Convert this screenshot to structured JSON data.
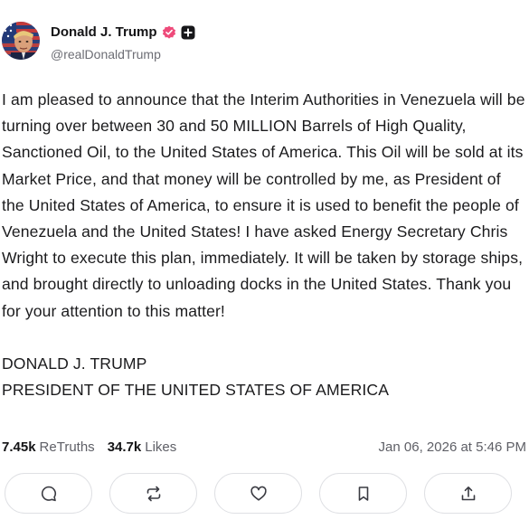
{
  "author": {
    "display_name": "Donald J. Trump",
    "handle": "@realDonaldTrump"
  },
  "post": {
    "paragraphs": [
      "I am pleased to announce that the Interim Authorities in Venezuela will be turning over between 30 and 50 MILLION Barrels of High Quality, Sanctioned Oil, to the United States of America. This Oil will be sold at its Market Price, and that money will be controlled by me, as President of the United States of America, to ensure it is used to benefit the people of Venezuela and the United States! I have asked Energy Secretary Chris Wright to execute this plan, immediately. It will be taken by storage ships, and brought directly to unloading docks in the United States. Thank you for your attention to this matter!",
      "DONALD J. TRUMP\nPRESIDENT OF THE UNITED STATES OF AMERICA"
    ]
  },
  "stats": {
    "retruths_count": "7.45k",
    "retruths_label": "ReTruths",
    "likes_count": "34.7k",
    "likes_label": "Likes",
    "timestamp": "Jan 06, 2026 at 5:46 PM"
  },
  "actions": [
    {
      "name": "reply",
      "icon": "comment-icon"
    },
    {
      "name": "retruth",
      "icon": "repost-icon"
    },
    {
      "name": "like",
      "icon": "heart-icon"
    },
    {
      "name": "bookmark",
      "icon": "bookmark-icon"
    },
    {
      "name": "share",
      "icon": "share-icon"
    }
  ],
  "colors": {
    "verified_badge": "#ee4a7a",
    "text": "#1b1b1d",
    "secondary_text": "#5e5f66",
    "button_border": "#dfe0e4"
  }
}
